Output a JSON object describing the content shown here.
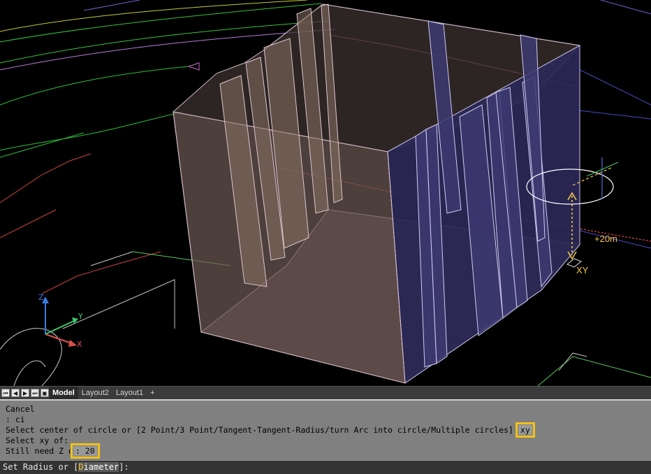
{
  "viewport": {
    "annotation_elevation": "+20m",
    "annotation_plane": "XY",
    "axis_labels": {
      "x": "X",
      "y": "Y",
      "z": "Z"
    }
  },
  "tabs": {
    "items": [
      {
        "label": "Model",
        "active": true
      },
      {
        "label": "Layout2",
        "active": false
      },
      {
        "label": "Layout1",
        "active": false
      }
    ],
    "add_label": "+"
  },
  "command_history": {
    "lines": [
      "Cancel",
      ": ci",
      "Select center of circle or [2 Point/3 Point/Tangent-Tangent-Radius/turn Arc into circle/Multiple circles]:",
      "Select xy of:",
      "Still need Z o"
    ],
    "highlighted_xy": "xy",
    "highlighted_z": ": 20"
  },
  "command_prompt": {
    "prefix": "Set Radius or [",
    "option_key": "D",
    "option_rest": "iameter",
    "suffix": "]:"
  },
  "colors": {
    "highlight": "#f2c21b",
    "annotation": "#f5c84a",
    "building_front": "#6e5a55",
    "building_side": "#2a2756"
  }
}
